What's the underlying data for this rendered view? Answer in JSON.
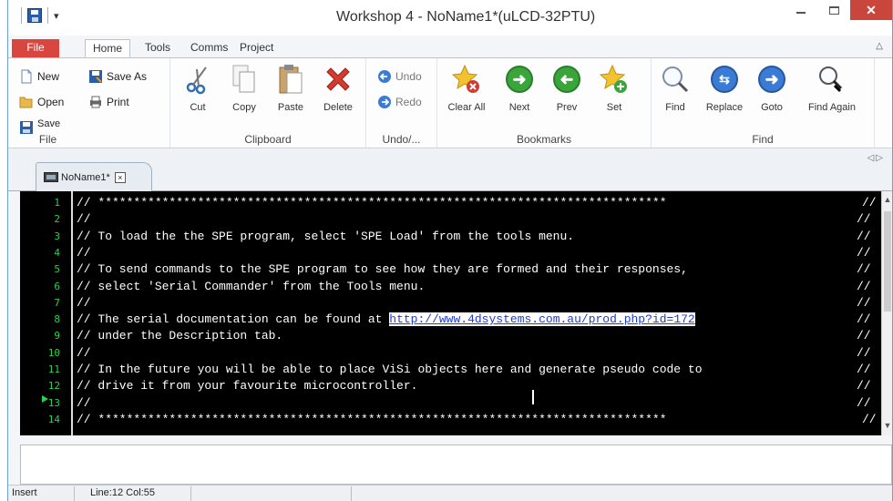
{
  "window": {
    "title": "Workshop 4 - NoName1*(uLCD-32PTU)",
    "qat_dropdown": "▾",
    "minimize": "—",
    "close": "✕"
  },
  "ribbon_tabs": [
    "File",
    "Home",
    "Tools",
    "Comms",
    "Project"
  ],
  "ribbon": {
    "file_group": {
      "label": "File",
      "new": "New",
      "save_as": "Save As",
      "open": "Open",
      "print": "Print",
      "save": "Save"
    },
    "clipboard_group": {
      "label": "Clipboard",
      "cut": "Cut",
      "copy": "Copy",
      "paste": "Paste",
      "delete": "Delete"
    },
    "undo_group": {
      "label": "Undo/...",
      "undo": "Undo",
      "redo": "Redo"
    },
    "bookmarks_group": {
      "label": "Bookmarks",
      "clear_all": "Clear All",
      "next": "Next",
      "prev": "Prev",
      "set": "Set"
    },
    "find_group": {
      "label": "Find",
      "find": "Find",
      "replace": "Replace",
      "goto": "Goto",
      "find_again": "Find Again"
    }
  },
  "doc_tab": {
    "label": "NoName1*",
    "close": "×"
  },
  "editor": {
    "line_numbers": [
      "1",
      "2",
      "3",
      "4",
      "5",
      "6",
      "7",
      "8",
      "9",
      "10",
      "11",
      "12",
      "13",
      "14"
    ],
    "lines": [
      "// ********************************************************************************",
      "//",
      "// To load the the SPE program, select 'SPE Load' from the tools menu.",
      "//",
      "// To send commands to the SPE program to see how they are formed and their responses,",
      "// select 'Serial Commander' from the Tools menu.",
      "//",
      "// The serial documentation can be found at ",
      "// under the Description tab.",
      "//",
      "// In the future you will be able to place ViSi objects here and generate pseudo code to",
      "// drive it from your favourite microcontroller.",
      "//",
      "// ********************************************************************************"
    ],
    "right_comment": "//",
    "link": "http://www.4dsystems.com.au/prod.php?id=172"
  },
  "status": {
    "mode": "Insert",
    "position": "Line:12 Col:55"
  },
  "colors": {
    "accent_file_tab": "#d9463f",
    "line_numbers": "#2ed050",
    "editor_bg": "#000000"
  }
}
